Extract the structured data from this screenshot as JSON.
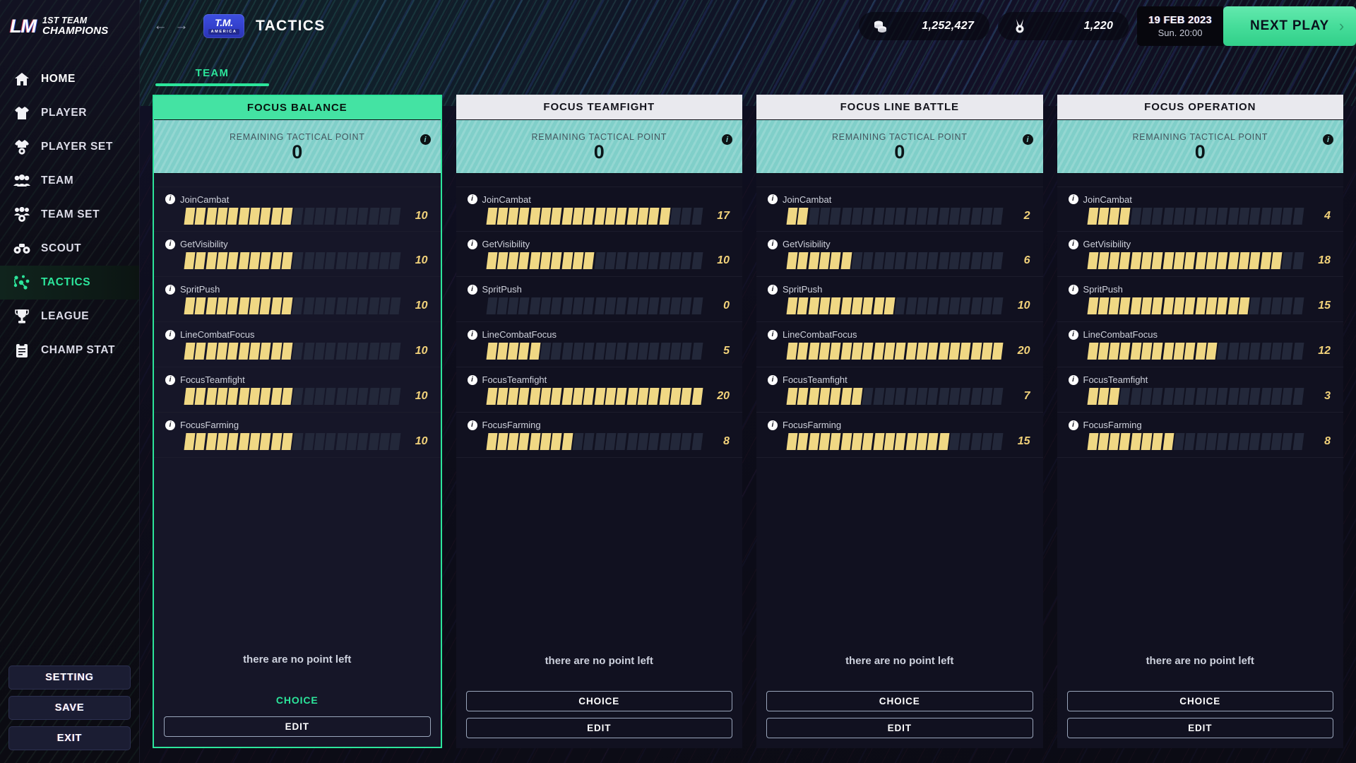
{
  "brand": {
    "mark": "LM",
    "line1": "1ST TEAM",
    "line2": "CHAMPIONS"
  },
  "sidebar": {
    "items": [
      {
        "label": "HOME",
        "icon": "home-icon",
        "active": false
      },
      {
        "label": "PLAYER",
        "icon": "jersey-icon",
        "active": false
      },
      {
        "label": "PLAYER SET",
        "icon": "jersey-gear-icon",
        "active": false
      },
      {
        "label": "TEAM",
        "icon": "people-icon",
        "active": false
      },
      {
        "label": "TEAM SET",
        "icon": "people-gear-icon",
        "active": false
      },
      {
        "label": "SCOUT",
        "icon": "binoculars-icon",
        "active": false
      },
      {
        "label": "TACTICS",
        "icon": "tactics-icon",
        "active": true
      },
      {
        "label": "LEAGUE",
        "icon": "trophy-icon",
        "active": false
      },
      {
        "label": "CHAMP STAT",
        "icon": "clipboard-icon",
        "active": false
      }
    ],
    "actions": [
      {
        "label": "SETTING"
      },
      {
        "label": "SAVE"
      },
      {
        "label": "EXIT"
      }
    ]
  },
  "header": {
    "back_icon": "arrow-left-icon",
    "forward_icon": "arrow-right-icon",
    "club_badge_line1": "T.M.",
    "club_badge_line2": "AMERICA",
    "title": "TACTICS",
    "money": {
      "icon": "coins-icon",
      "value": "1,252,427"
    },
    "points": {
      "icon": "medal-icon",
      "value": "1,220"
    },
    "date": "19 FEB 2023",
    "time": "Sun. 20:00",
    "next_play_label": "NEXT PLAY",
    "next_play_chevron": "chevron-right-icon"
  },
  "tabs": [
    {
      "label": "TEAM",
      "active": true
    }
  ],
  "common": {
    "remaining_label": "REMAINING TACTICAL POINT",
    "info_glyph": "i",
    "no_point_text": "there are no point left",
    "choice_label": "CHOICE",
    "edit_label": "EDIT",
    "bar_max": 20
  },
  "accent": {
    "green": "#2ce59b",
    "bar_fill": "#f0d884",
    "bar_empty": "#23283a",
    "teal_band": "#80cfc9",
    "head_light": "#e9e9ee"
  },
  "cards": [
    {
      "title": "FOCUS BALANCE",
      "selected": true,
      "remaining": "0",
      "stats": [
        {
          "name": "JoinCambat",
          "value": 10
        },
        {
          "name": "GetVisibility",
          "value": 10
        },
        {
          "name": "SpritPush",
          "value": 10
        },
        {
          "name": "LineCombatFocus",
          "value": 10
        },
        {
          "name": "FocusTeamfight",
          "value": 10
        },
        {
          "name": "FocusFarming",
          "value": 10
        }
      ]
    },
    {
      "title": "FOCUS TEAMFIGHT",
      "selected": false,
      "remaining": "0",
      "stats": [
        {
          "name": "JoinCambat",
          "value": 17
        },
        {
          "name": "GetVisibility",
          "value": 10
        },
        {
          "name": "SpritPush",
          "value": 0
        },
        {
          "name": "LineCombatFocus",
          "value": 5
        },
        {
          "name": "FocusTeamfight",
          "value": 20
        },
        {
          "name": "FocusFarming",
          "value": 8
        }
      ]
    },
    {
      "title": "FOCUS LINE BATTLE",
      "selected": false,
      "remaining": "0",
      "stats": [
        {
          "name": "JoinCambat",
          "value": 2
        },
        {
          "name": "GetVisibility",
          "value": 6
        },
        {
          "name": "SpritPush",
          "value": 10
        },
        {
          "name": "LineCombatFocus",
          "value": 20
        },
        {
          "name": "FocusTeamfight",
          "value": 7
        },
        {
          "name": "FocusFarming",
          "value": 15
        }
      ]
    },
    {
      "title": "FOCUS OPERATION",
      "selected": false,
      "remaining": "0",
      "stats": [
        {
          "name": "JoinCambat",
          "value": 4
        },
        {
          "name": "GetVisibility",
          "value": 18
        },
        {
          "name": "SpritPush",
          "value": 15
        },
        {
          "name": "LineCombatFocus",
          "value": 12
        },
        {
          "name": "FocusTeamfight",
          "value": 3
        },
        {
          "name": "FocusFarming",
          "value": 8
        }
      ]
    }
  ]
}
